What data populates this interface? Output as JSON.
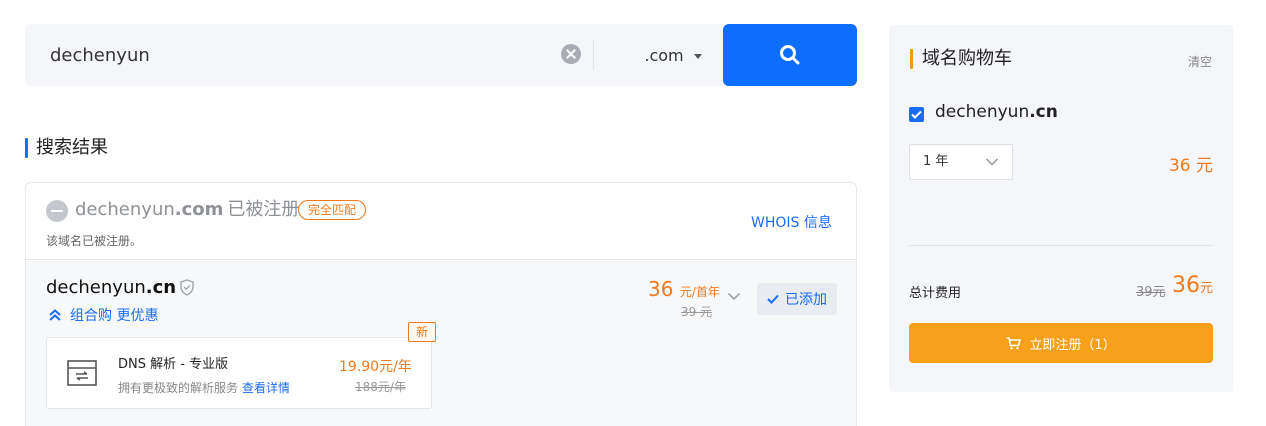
{
  "search": {
    "value": "dechenyun",
    "tld": ".com"
  },
  "results": {
    "title": "搜索结果",
    "taken": {
      "name": "dechenyun",
      "tld": ".com",
      "status": "已被注册",
      "badge": "完全匹配",
      "note": "该域名已被注册。",
      "whois": "WHOIS 信息"
    },
    "available": {
      "name": "dechenyun",
      "tld": ".cn",
      "combo": "组合购 更优惠",
      "price": "36",
      "price_unit": "元/首年",
      "price_orig": "39 元",
      "added": "已添加",
      "addon": {
        "badge": "新",
        "title": "DNS 解析 - 专业版",
        "desc": "拥有更极致的解析服务",
        "detail": "查看详情",
        "price": "19.90元/年",
        "price_orig": "188元/年"
      }
    }
  },
  "cart": {
    "title": "域名购物车",
    "clear": "清空",
    "item": {
      "name": "dechenyun",
      "tld": ".cn",
      "years": "1 年",
      "price": "36 元"
    },
    "total_label": "总计费用",
    "total_orig": "39元",
    "total": "36",
    "total_unit": "元",
    "register": "立即注册（1）"
  },
  "colors": {
    "primary": "#0d6efd",
    "link": "#1a6cf3",
    "price": "#f07a1d",
    "cta": "#f9a01b"
  }
}
